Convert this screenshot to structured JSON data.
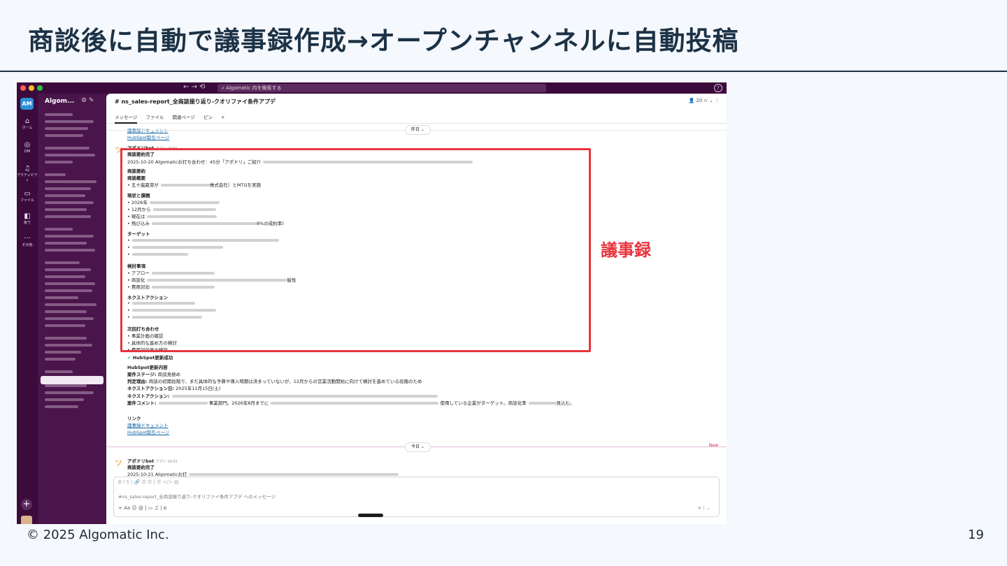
{
  "slide": {
    "title": "商談後に自動で議事録作成→オープンチャンネルに自動投稿",
    "copyright": "© 2025 Algomatic Inc.",
    "page_number": "19",
    "highlight_label": "議事録"
  },
  "app": {
    "search_placeholder": "Algomatic 内を検索する",
    "nav_arrows": "←  →  ⟲",
    "workspace_initials": "AM",
    "workspace_name": "Algom...",
    "rail": [
      {
        "icon": "⌂",
        "label": "ホーム"
      },
      {
        "icon": "◎",
        "label": "DM"
      },
      {
        "icon": "♫",
        "label": "アクティビティ"
      },
      {
        "icon": "▭",
        "label": "ファイル"
      },
      {
        "icon": "◧",
        "label": "後で"
      },
      {
        "icon": "···",
        "label": "その他"
      }
    ]
  },
  "channel": {
    "name": "# ns_sales-report_全商談振り返り-クオリファイ条件アプデ",
    "member_count": "20",
    "tabs": [
      "メッセージ",
      "ファイル",
      "関連ページ",
      "ピン",
      "+"
    ]
  },
  "messages": {
    "prev_link1": "議事録ドキュメント",
    "prev_link2": "HubSpot取引ページ",
    "day_yesterday": "昨日",
    "bot_name": "アポドリbot",
    "bot_tag": "アプリ",
    "bot_time": "16:01",
    "summary_done": "商談要約完了",
    "meeting_line": "2025-10-20 Algomaticお打ち合わせ：45分「アポドリ」ご紹介",
    "summary_head": "商談要約",
    "overview_head": "商談概要",
    "overview_item": "• 五十嵐夏菜が",
    "overview_item_end": "株式会社）とMTGを実施",
    "status_head": "現状と課題",
    "status_items": [
      "• 2026年",
      "• 12月から",
      "• 現在は",
      "• 飛び込み"
    ],
    "status_end": "8%の成約率)",
    "target_head": "ターゲット",
    "target_items": [
      "•",
      "•",
      "•"
    ],
    "consider_head": "検討事項",
    "consider_items": [
      "• アプロー",
      "• 商談化",
      "• 費用対効"
    ],
    "consider_end": "能性",
    "next_head": "ネクストアクション",
    "next_items": [
      "•",
      "•",
      "•"
    ],
    "next_meeting_head": "次回打ち合わせ",
    "next_meeting_items": [
      "• 事業計画の確認",
      "• 具体的な進め方の検討",
      "• 費用対効果の検証"
    ],
    "hubspot_success": "HubSpot更新成功",
    "hubspot_content_head": "HubSpot更新内容",
    "deal_stage_label": "案件ステージ:",
    "deal_stage_value": "商談見極め",
    "reason_label": "判定理由:",
    "reason_value": "商談の初期段階で、まだ具体的な予算や導入時期は決まっていないが、12月からの営業活動開始に向けて検討を進めている段階のため",
    "next_action_date_label": "ネクストアクション日:",
    "next_action_date_value": "2025年11月15日(土)",
    "next_action_label": "ネクストアクション:",
    "deal_comment_label": "案件コメント:",
    "deal_comment_value": "事業部門。2026年8月までに",
    "deal_comment_end": "使用している企業がターゲット。商談化率",
    "deal_comment_tail": "見込む。",
    "links_head": "リンク",
    "link1": "議事録ドキュメント",
    "link2": "HubSpot取引ページ",
    "day_today": "今日",
    "new_label": "New",
    "bot2_name": "アポドリbot",
    "bot2_tag": "アプリ",
    "bot2_time": "16:01",
    "bot2_summary": "商談要約完了",
    "bot2_line": "2025-10-21 Algomaticお打"
  },
  "composer": {
    "format_bar": "B  I  S  |  🔗  ☰  ☰  |  ☰  </>  ▤",
    "placeholder": "#ns_sales-report_全商談振り返り-クオリファイ条件アプデ へのメッセージ",
    "tools": "+   Aa   ☺   @   |   ▭   ♫   |   ⧄",
    "send": "➤  |  ⌄"
  },
  "colors": {
    "title": "#1c3246",
    "slack_aubergine": "#4a154b",
    "highlight_red": "#e8343e",
    "link_blue": "#1264a3"
  }
}
